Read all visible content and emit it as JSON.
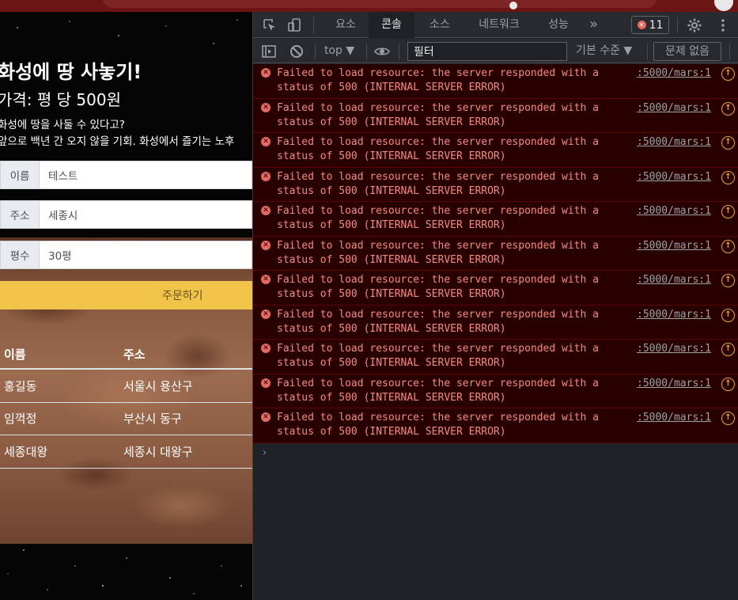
{
  "page": {
    "title": "화성에 땅 사놓기!",
    "price": "가격: 평 당 500원",
    "desc1": "화성에 땅을 사둘 수 있다고?",
    "desc2": "앞으로 백년 간 오지 않을 기회. 화성에서 즐기는 노후",
    "fields": [
      {
        "label": "이름",
        "value": "테스트"
      },
      {
        "label": "주소",
        "value": "세종시"
      },
      {
        "label": "평수",
        "value": "30평"
      }
    ],
    "order_button": "주문하기",
    "table": {
      "headers": [
        "이름",
        "주소"
      ],
      "rows": [
        [
          "홍길동",
          "서울시 용산구"
        ],
        [
          "임꺽정",
          "부산시 동구"
        ],
        [
          "세종대왕",
          "세종시 대왕구"
        ]
      ]
    }
  },
  "devtools": {
    "tabs": [
      {
        "label": "요소",
        "active": false
      },
      {
        "label": "콘솔",
        "active": true
      },
      {
        "label": "소스",
        "active": false
      },
      {
        "label": "네트워크",
        "active": false
      },
      {
        "label": "성능",
        "active": false
      }
    ],
    "more_tabs": "»",
    "error_count": "11",
    "toolbar": {
      "context": "top ▼",
      "filter_value": "필터",
      "level": "기본 수준 ▼",
      "issues": "문제 없음"
    },
    "messages": [
      {
        "text": "Failed to load resource: the server responded with a status of 500 (INTERNAL SERVER ERROR)",
        "source": ":5000/mars:1"
      },
      {
        "text": "Failed to load resource: the server responded with a status of 500 (INTERNAL SERVER ERROR)",
        "source": ":5000/mars:1"
      },
      {
        "text": "Failed to load resource: the server responded with a status of 500 (INTERNAL SERVER ERROR)",
        "source": ":5000/mars:1"
      },
      {
        "text": "Failed to load resource: the server responded with a status of 500 (INTERNAL SERVER ERROR)",
        "source": ":5000/mars:1"
      },
      {
        "text": "Failed to load resource: the server responded with a status of 500 (INTERNAL SERVER ERROR)",
        "source": ":5000/mars:1"
      },
      {
        "text": "Failed to load resource: the server responded with a status of 500 (INTERNAL SERVER ERROR)",
        "source": ":5000/mars:1"
      },
      {
        "text": "Failed to load resource: the server responded with a status of 500 (INTERNAL SERVER ERROR)",
        "source": ":5000/mars:1"
      },
      {
        "text": "Failed to load resource: the server responded with a status of 500 (INTERNAL SERVER ERROR)",
        "source": ":5000/mars:1"
      },
      {
        "text": "Failed to load resource: the server responded with a status of 500 (INTERNAL SERVER ERROR)",
        "source": ":5000/mars:1"
      },
      {
        "text": "Failed to load resource: the server responded with a status of 500 (INTERNAL SERVER ERROR)",
        "source": ":5000/mars:1"
      },
      {
        "text": "Failed to load resource: the server responded with a status of 500 (INTERNAL SERVER ERROR)",
        "source": ":5000/mars:1"
      }
    ],
    "prompt": "›",
    "colors": {
      "error_text": "#f28b82",
      "error_bg": "#290000",
      "accent_button": "#f0c448"
    }
  }
}
